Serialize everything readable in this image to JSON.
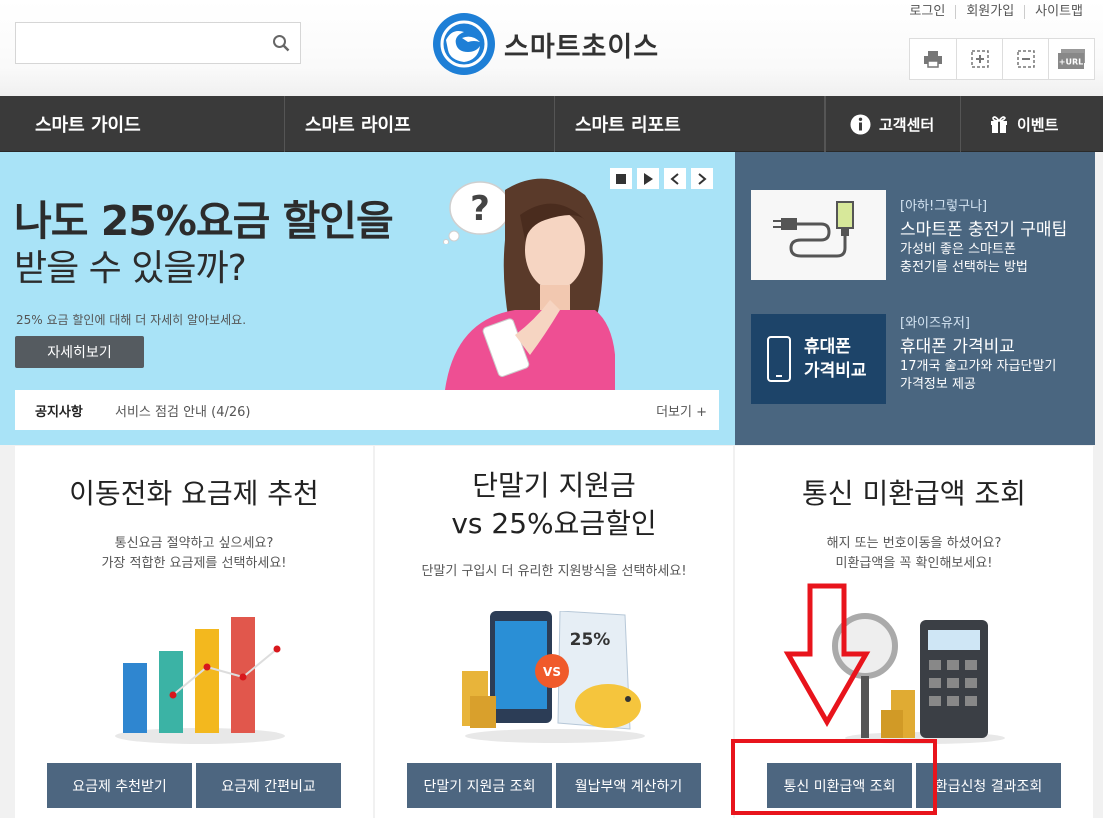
{
  "header": {
    "search_placeholder": "",
    "search_icon": "search-icon",
    "logo_text": "스마트초이스",
    "top_links": [
      "로그인",
      "회원가입",
      "사이트맵"
    ],
    "tools": [
      "print-icon",
      "zoom-in-icon",
      "zoom-out-icon",
      "url-icon"
    ],
    "tool_url_label": "+URL"
  },
  "nav": {
    "items": [
      "스마트 가이드",
      "스마트 라이프",
      "스마트 리포트"
    ],
    "support": "고객센터",
    "event": "이벤트"
  },
  "hero": {
    "title_line1": "나도 25%요금 할인을",
    "title_line2": "받을 수 있을까?",
    "description": "25% 요금 할인에 대해 더 자세히 알아보세요.",
    "button": "자세히보기",
    "bubble_glyph": "?",
    "notice_label": "공지사항",
    "notice_text": "서비스 점검 안내 (4/26)",
    "notice_more": "더보기 +"
  },
  "side": {
    "card1": {
      "category": "[아하!그렇구나]",
      "title": "스마트폰 충전기 구매팁",
      "sub1": "가성비 좋은 스마트폰",
      "sub2": "충전기를 선택하는 방법"
    },
    "card2": {
      "category": "[와이즈유저]",
      "title": "휴대폰 가격비교",
      "sub1": "17개국 출고가와 자급단말기",
      "sub2": "가격정보 제공",
      "thumb_line1": "휴대폰",
      "thumb_line2": "가격비교"
    }
  },
  "columns": [
    {
      "title": "이동전화 요금제 추천",
      "line1": "통신요금 절약하고 싶으세요?",
      "line2": "가장 적합한 요금제를 선택하세요!",
      "btn1": "요금제 추천받기",
      "btn2": "요금제 간편비교"
    },
    {
      "title1": "단말기 지원금",
      "title2": "vs 25%요금할인",
      "line1": "단말기 구입시 더 유리한 지원방식을 선택하세요!",
      "btn1": "단말기 지원금 조회",
      "btn2": "월납부액 계산하기",
      "vs_label": "VS",
      "pct_label": "25%"
    },
    {
      "title": "통신 미환급액 조회",
      "line1": "해지 또는 번호이동을 하셨어요?",
      "line2": "미환급액을 꼭 확인해보세요!",
      "btn1": "통신 미환급액 조회",
      "btn2": "환급신청 결과조회"
    }
  ],
  "colors": {
    "accent": "#4d6680",
    "highlight": "#e8141c",
    "hero_bg": "#a9e3f7",
    "nav_bg": "#3a3a3a"
  }
}
